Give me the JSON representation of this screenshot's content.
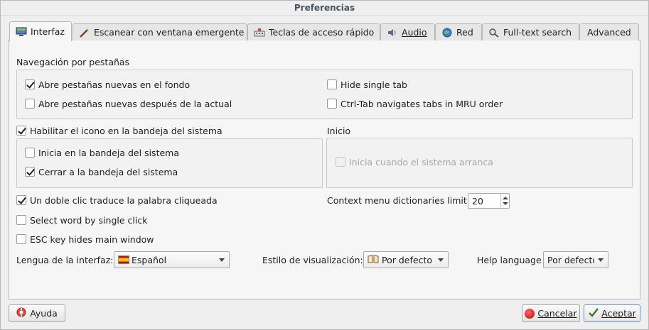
{
  "window": {
    "title": "Preferencias"
  },
  "tabs": [
    {
      "label": "Interfaz",
      "icon": "monitor-icon"
    },
    {
      "label": "Escanear con ventana emergente",
      "icon": "wand-icon"
    },
    {
      "label": "Teclas de acceso rápido",
      "icon": "keyboard-icon"
    },
    {
      "label": "Audio",
      "icon": "speaker-icon"
    },
    {
      "label": "Red",
      "icon": "globe-icon"
    },
    {
      "label": "Full-text search",
      "icon": "magnifier-icon"
    },
    {
      "label": "Advanced",
      "icon": ""
    }
  ],
  "tabs_state": {
    "active": "Interfaz"
  },
  "nav_group": {
    "title": "Navegación por pestañas",
    "open_background": {
      "label": "Abre pestañas nuevas en el fondo",
      "checked": true
    },
    "open_after_current": {
      "label": "Abre pestañas nuevas después de la actual",
      "checked": false
    },
    "hide_single_tab": {
      "label": "Hide single tab",
      "checked": false
    },
    "ctrl_tab_mru": {
      "label": "Ctrl-Tab navigates tabs in MRU order",
      "checked": false
    }
  },
  "tray_group": {
    "enable_tray": {
      "label": "Habilitar el icono en la bandeja del sistema",
      "checked": true
    },
    "start_in_tray": {
      "label": "Inicia en la bandeja del sistema",
      "checked": false
    },
    "close_to_tray": {
      "label": "Cerrar a la bandeja del sistema",
      "checked": true
    }
  },
  "startup_group": {
    "title": "Inicio",
    "start_with_system": {
      "label": "Inicia cuando el sistema arranca",
      "checked": false,
      "disabled": true
    }
  },
  "options": {
    "double_click": {
      "label": "Un doble clic traduce la palabra cliqueada",
      "checked": true
    },
    "single_click": {
      "label": "Select word by single click",
      "checked": false
    },
    "esc_hides": {
      "label": "ESC key hides main window",
      "checked": false
    }
  },
  "context_limit": {
    "label": "Context menu dictionaries limit:",
    "value": "20"
  },
  "interface_language": {
    "label": "Lengua de la interfaz:",
    "value": "Español"
  },
  "display_style": {
    "label": "Estilo de visualización:",
    "value": "Por defecto"
  },
  "help_language": {
    "label": "Help language",
    "value": "Por defecto"
  },
  "buttons": {
    "help": "Ayuda",
    "cancel": "Cancelar",
    "ok": "Aceptar"
  }
}
